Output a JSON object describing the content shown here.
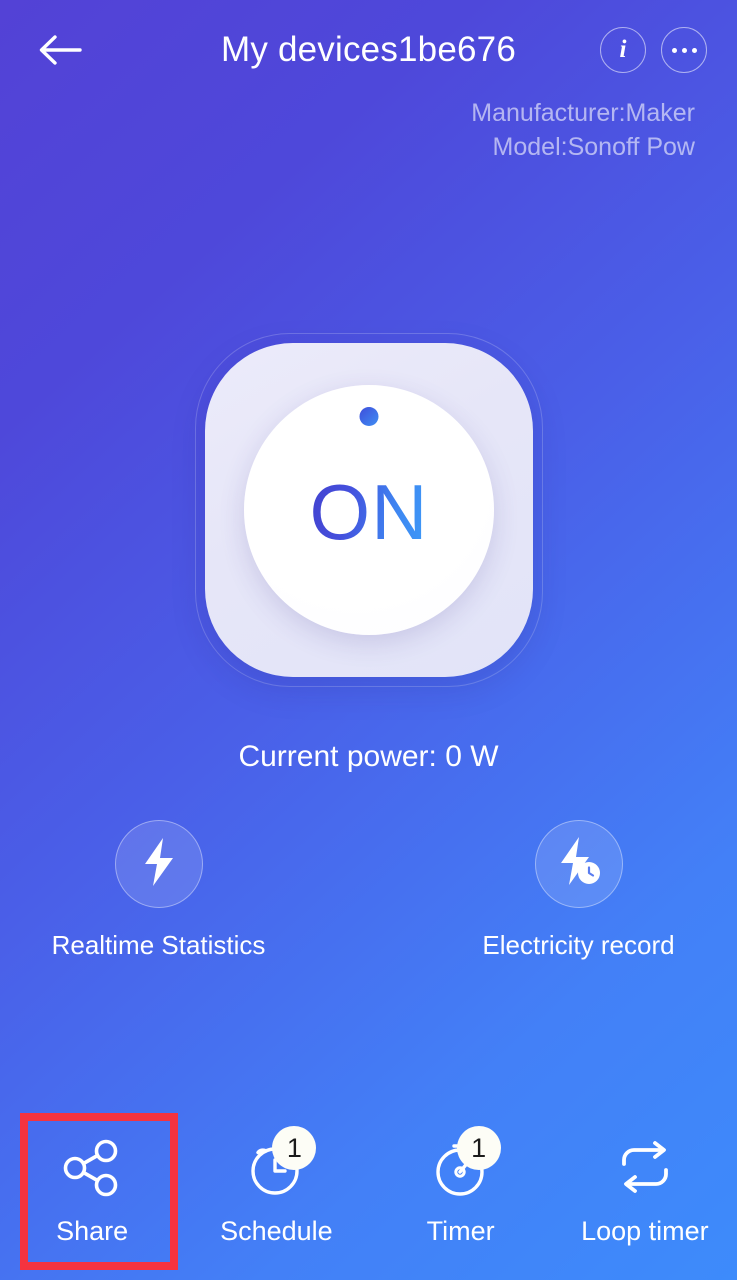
{
  "header": {
    "back_icon": "arrow-left-icon",
    "title": "My devices1be676",
    "info_icon": "info-icon",
    "info_glyph": "i",
    "menu_icon": "more-options-icon"
  },
  "device_meta": {
    "manufacturer": "Manufacturer:Maker",
    "model": "Model:Sonoff Pow"
  },
  "toggle": {
    "state": "ON",
    "indicator_icon": "status-dot-icon"
  },
  "power": {
    "text": "Current power: 0 W"
  },
  "actions": [
    {
      "label": "Realtime Statistics",
      "icon": "lightning-bolt-icon"
    },
    {
      "label": "Electricity record",
      "icon": "lightning-bolt-clock-icon"
    }
  ],
  "bottom_nav": [
    {
      "label": "Share",
      "icon": "share-nodes-icon",
      "badge": ""
    },
    {
      "label": "Schedule",
      "icon": "alarm-clock-icon",
      "badge": "1"
    },
    {
      "label": "Timer",
      "icon": "stopwatch-icon",
      "badge": "1"
    },
    {
      "label": "Loop timer",
      "icon": "loop-repeat-icon",
      "badge": ""
    }
  ],
  "colors": {
    "gradient_start": "#5342d6",
    "gradient_end": "#3d8bfb",
    "highlight_box": "#f5333f",
    "toggle_text_start": "#4342cf",
    "toggle_text_end": "#3d9bf8",
    "badge_background": "#fdfdf6"
  }
}
